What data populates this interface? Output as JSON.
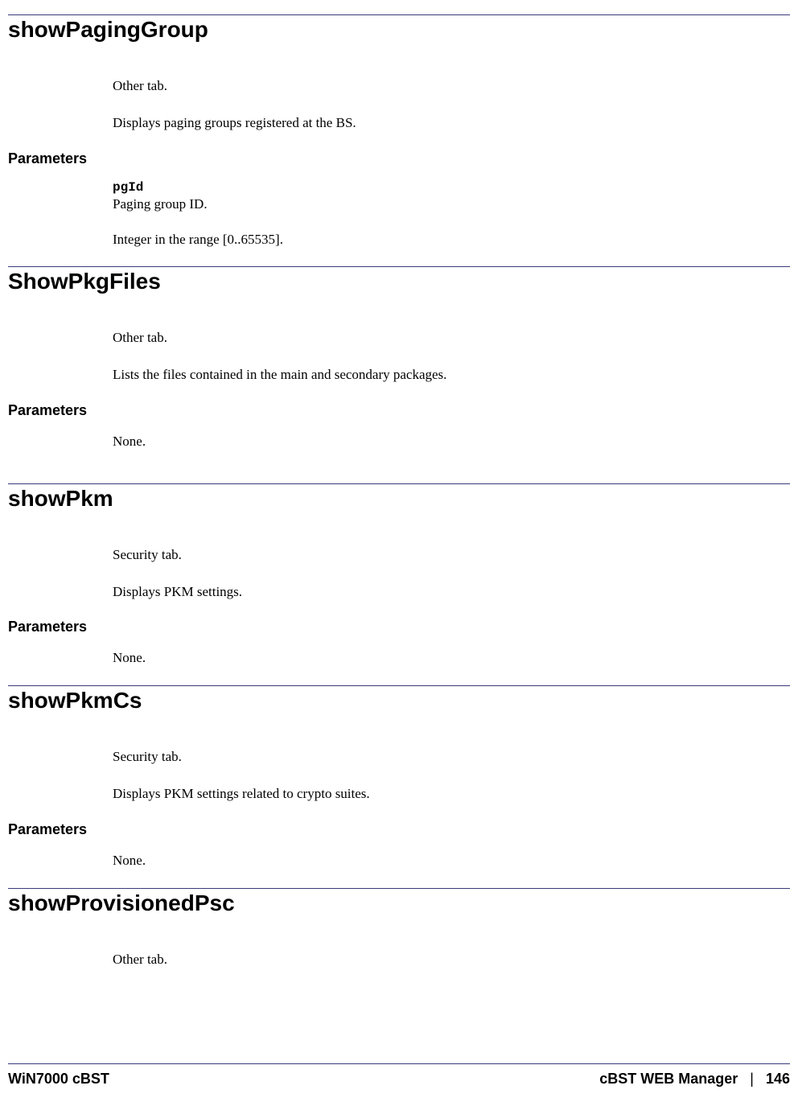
{
  "sections": [
    {
      "title": "showPagingGroup",
      "body": [
        "Other tab.",
        "Displays paging groups registered at the BS."
      ],
      "parameters_label": "Parameters",
      "params": [
        {
          "name": "pgId",
          "desc": "Paging group ID."
        }
      ],
      "post_params_body": [
        "Integer in the range [0..65535]."
      ],
      "gap_top": false
    },
    {
      "title": "ShowPkgFiles",
      "body": [
        "Other tab.",
        "Lists the files contained in the main and secondary packages."
      ],
      "parameters_label": "Parameters",
      "params": [],
      "post_params_body": [
        "None."
      ],
      "gap_top": false
    },
    {
      "title": "showPkm",
      "body": [
        "Security tab.",
        "Displays PKM settings."
      ],
      "parameters_label": "Parameters",
      "params": [],
      "post_params_body": [
        "None."
      ],
      "gap_top": true
    },
    {
      "title": "showPkmCs",
      "body": [
        "Security tab.",
        "Displays PKM settings related to crypto suites."
      ],
      "parameters_label": "Parameters",
      "params": [],
      "post_params_body": [
        "None."
      ],
      "gap_top": false
    },
    {
      "title": "showProvisionedPsc",
      "body": [
        "Other tab."
      ],
      "parameters_label": "",
      "params": [],
      "post_params_body": [],
      "gap_top": false
    }
  ],
  "footer": {
    "left": "WiN7000 cBST",
    "right_text": "cBST WEB Manager",
    "separator": "|",
    "page": "146"
  }
}
